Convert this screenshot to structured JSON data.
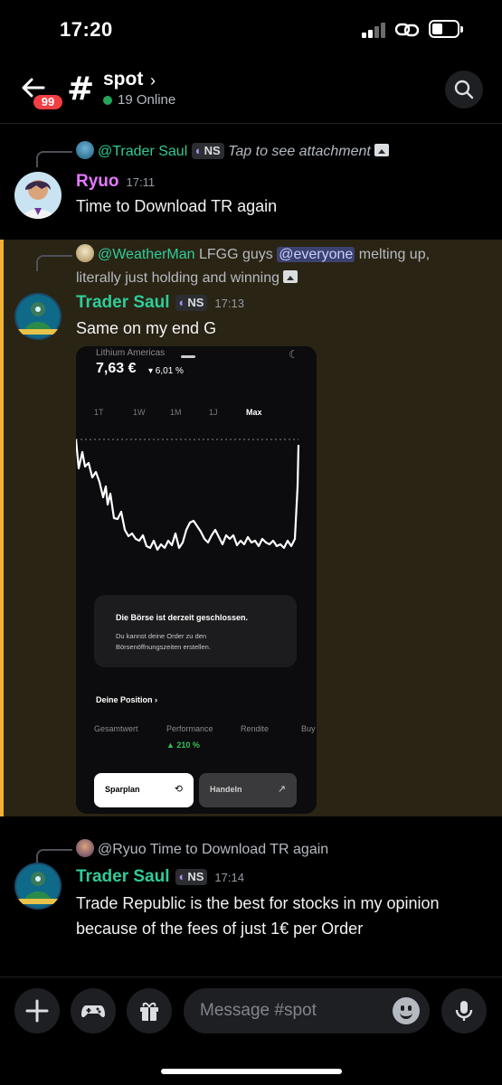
{
  "status_bar": {
    "time": "17:20"
  },
  "header": {
    "unread_badge": "99",
    "channel_name": "spot",
    "online_text": "19 Online"
  },
  "messages": [
    {
      "reply": {
        "author": "@Trader Saul",
        "tag": "NS",
        "text": "Tap to see attachment"
      },
      "author": "Ryuo",
      "time": "17:11",
      "text": "Time to Download TR again"
    },
    {
      "reply": {
        "author": "@WeatherMan",
        "text_before": "LFGG guys",
        "mention": "@everyone",
        "text_after": "melting up,",
        "text_line2": "literally just holding and winning"
      },
      "author": "Trader Saul",
      "tag": "NS",
      "time": "17:13",
      "text": "Same on my end G",
      "attachment": {
        "asset": "Lithium Americas",
        "price": "7,63 €",
        "change": "▾ 6,01 %",
        "ranges": [
          "1T",
          "1W",
          "1M",
          "1J",
          "Max"
        ],
        "selected_range": "Max",
        "notice_title": "Die Börse ist derzeit geschlossen.",
        "notice_text": "Du kannst deine Order zu den Börsenöffnungszeiten erstellen.",
        "position_label": "Deine Position  ›",
        "stats": [
          "Gesamtwert",
          "Performance",
          "Rendite",
          "Buy"
        ],
        "performance": "▲ 210 %",
        "button_primary": "Sparplan",
        "button_secondary": "Handeln"
      }
    },
    {
      "reply": {
        "author": "@Ryuo",
        "text": "Time to Download TR again"
      },
      "author": "Trader Saul",
      "tag": "NS",
      "time": "17:14",
      "text": "Trade Republic is the best for stocks in my opinion because of the fees of just 1€ per Order"
    }
  ],
  "composer": {
    "placeholder": "Message #spot"
  },
  "colors": {
    "background": "#000000",
    "highlight_bg": "#2a2414",
    "highlight_bar": "#f0b232",
    "author_ryuo": "#e478ff",
    "author_saul": "#2fcc9a",
    "online": "#23a55a",
    "badge": "#f23f43"
  }
}
